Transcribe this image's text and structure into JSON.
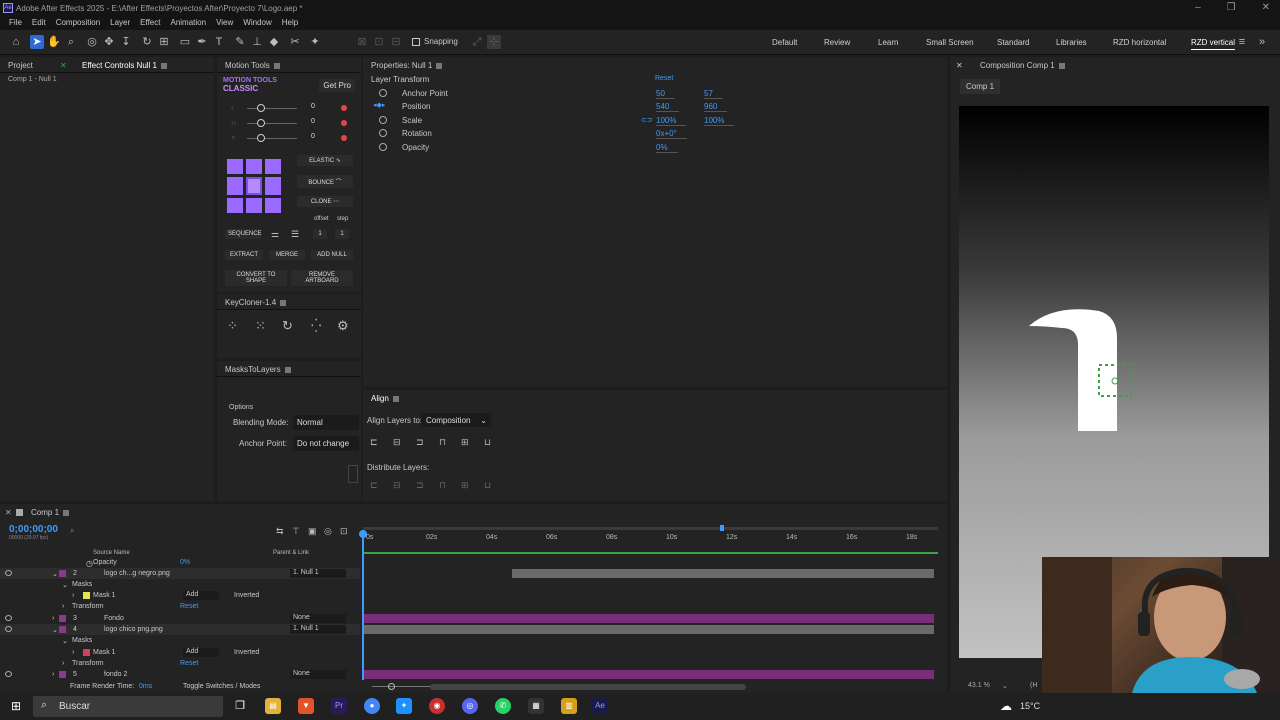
{
  "window": {
    "title": "Adobe After Effects 2025 - E:\\After Effects\\Proyectos After\\Proyecto 7\\Logo.aep *",
    "app_badge": "Ae",
    "controls": [
      "–",
      "❐",
      "✕"
    ]
  },
  "menu": [
    "File",
    "Edit",
    "Composition",
    "Layer",
    "Effect",
    "Animation",
    "View",
    "Window",
    "Help"
  ],
  "toolbar": {
    "snapping_label": "Snapping",
    "workspaces": [
      "Default",
      "Review",
      "Learn",
      "Small Screen",
      "Standard",
      "Libraries",
      "RZD horizontal",
      "RZD vertical"
    ],
    "active_workspace": "RZD vertical"
  },
  "project_panel": {
    "tab_project": "Project",
    "tab_effect_controls": "Effect Controls Null 1",
    "breadcrumb": "Comp 1 - Null 1"
  },
  "motion_tools": {
    "tab": "Motion Tools",
    "logo_line1": "MOTION TOOLS",
    "logo_line2": "CLASSIC",
    "get_pro": "Get Pro",
    "sliders": [
      {
        "value": "0"
      },
      {
        "value": "0"
      },
      {
        "value": "0"
      }
    ],
    "buttons": {
      "elastic": "ELASTIC",
      "bounce": "BOUNCE",
      "clone": "CLONE",
      "sequence": "SEQUENCE",
      "extract": "EXTRACT",
      "merge": "MERGE",
      "add_null": "ADD NULL",
      "convert_to_shape": "CONVERT TO SHAPE",
      "remove_artboard": "REMOVE ARTBOARD"
    },
    "offset_label": "offset",
    "step_label": "step",
    "offset_value": "1",
    "step_value": "1"
  },
  "keycloner": {
    "tab": "KeyCloner-1.4"
  },
  "masks_to_layers": {
    "tab": "MasksToLayers",
    "options_label": "Options",
    "blending_label": "Blending Mode:",
    "blending_value": "Normal",
    "anchor_label": "Anchor Point:",
    "anchor_value": "Do not change"
  },
  "properties": {
    "tab": "Properties: Null 1",
    "section": "Layer Transform",
    "reset": "Reset",
    "rows": [
      {
        "name": "Anchor Point",
        "v1": "50",
        "v2": "57"
      },
      {
        "name": "Position",
        "v1": "540",
        "v2": "960"
      },
      {
        "name": "Scale",
        "v1": "100%",
        "v2": "100%"
      },
      {
        "name": "Rotation",
        "v1": "0x+0°",
        "v2": ""
      },
      {
        "name": "Opacity",
        "v1": "0%",
        "v2": ""
      }
    ]
  },
  "align": {
    "tab": "Align",
    "align_to_label": "Align Layers to:",
    "align_to_value": "Composition",
    "distribute_label": "Distribute Layers:"
  },
  "composition": {
    "tab": "Composition Comp 1",
    "subtab": "Comp 1",
    "zoom": "43.1 %",
    "quality": "(H"
  },
  "timeline": {
    "tab": "Comp 1",
    "timecode": "0;00;00;00",
    "fps": "00000 (29.97 fps)",
    "header_source": "Source Name",
    "header_parent": "Parent & Link",
    "ruler_ticks": [
      "0s",
      "02s",
      "04s",
      "06s",
      "08s",
      "10s",
      "12s",
      "14s",
      "16s",
      "18s"
    ],
    "rows": [
      {
        "kind": "prop",
        "label": "Opacity",
        "value": "0%"
      },
      {
        "kind": "layer",
        "num": "2",
        "label": "logo ch...g negro.png",
        "parent": "1. Null 1"
      },
      {
        "kind": "group",
        "label": "Masks"
      },
      {
        "kind": "mask",
        "label": "Mask 1",
        "add": "Add",
        "mode": "Inverted"
      },
      {
        "kind": "group",
        "label": "Transform",
        "reset": "Reset"
      },
      {
        "kind": "layer",
        "num": "3",
        "label": "Fondo",
        "parent": "None"
      },
      {
        "kind": "layer",
        "num": "4",
        "label": "logo chico png.png",
        "parent": "1. Null 1"
      },
      {
        "kind": "group",
        "label": "Masks"
      },
      {
        "kind": "mask",
        "label": "Mask 1",
        "add": "Add",
        "mode": "Inverted"
      },
      {
        "kind": "group",
        "label": "Transform",
        "reset": "Reset"
      },
      {
        "kind": "layer",
        "num": "5",
        "label": "fondo 2",
        "parent": "None"
      }
    ],
    "frame_render_label": "Frame Render Time:",
    "frame_render_value": "0ms",
    "toggle_label": "Toggle Switches / Modes"
  },
  "taskbar": {
    "search_placeholder": "Buscar",
    "temperature": "15°C"
  },
  "colors": {
    "accent_blue": "#2d6ad7",
    "value_blue": "#3d9bff",
    "motion_purple": "#9b6bff",
    "layer_purple": "#8a3a8a",
    "workarea_green": "#3ea33e"
  }
}
